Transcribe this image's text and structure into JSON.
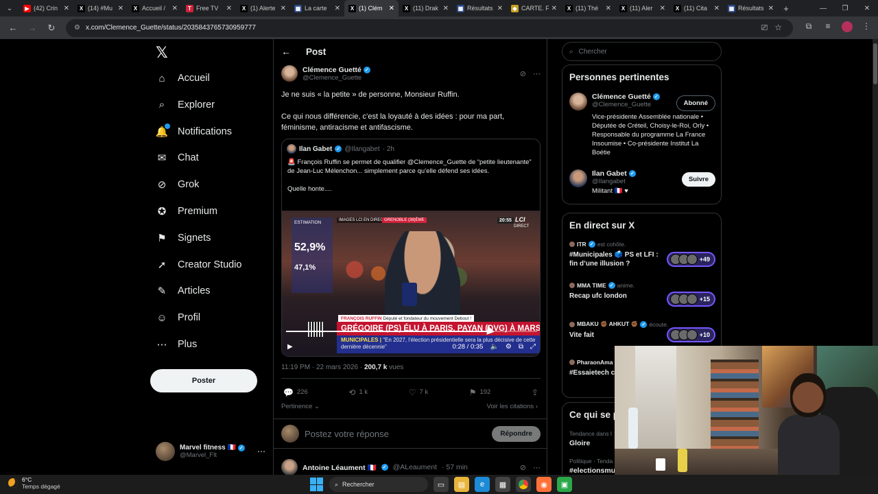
{
  "browser": {
    "tabs": [
      {
        "label": "(42) Crin",
        "fav": "▶",
        "color": "#ff0000"
      },
      {
        "label": "(14) #Mu",
        "fav": "X",
        "color": "#000000"
      },
      {
        "label": "Accueil /",
        "fav": "X",
        "color": "#000000"
      },
      {
        "label": "Free TV",
        "fav": "T",
        "color": "#d0213a"
      },
      {
        "label": "(1) Alerte",
        "fav": "X",
        "color": "#000000"
      },
      {
        "label": "La carte",
        "fav": "▦",
        "color": "#2a4a8a"
      },
      {
        "label": "(1) Clém",
        "fav": "X",
        "color": "#000000",
        "active": true
      },
      {
        "label": "(11) Drak",
        "fav": "X",
        "color": "#000000"
      },
      {
        "label": "Résultats",
        "fav": "▦",
        "color": "#2a4a8a"
      },
      {
        "label": "CARTE. F",
        "fav": "◆",
        "color": "#c8a020"
      },
      {
        "label": "(11) Thé",
        "fav": "X",
        "color": "#000000"
      },
      {
        "label": "(11) Aler",
        "fav": "X",
        "color": "#000000"
      },
      {
        "label": "(11) Cita",
        "fav": "X",
        "color": "#000000"
      },
      {
        "label": "Résultats",
        "fav": "▦",
        "color": "#2a4a8a"
      }
    ],
    "url": "x.com/Clemence_Guette/status/2035843765730959777"
  },
  "nav": {
    "items": [
      {
        "label": "Accueil",
        "icon": "home-icon",
        "glyph": "⌂"
      },
      {
        "label": "Explorer",
        "icon": "search-icon",
        "glyph": "⌕"
      },
      {
        "label": "Notifications",
        "icon": "bell-icon",
        "glyph": "🔔"
      },
      {
        "label": "Chat",
        "icon": "mail-icon",
        "glyph": "✉"
      },
      {
        "label": "Grok",
        "icon": "grok-icon",
        "glyph": "⊘"
      },
      {
        "label": "Premium",
        "icon": "premium-icon",
        "glyph": "✪"
      },
      {
        "label": "Signets",
        "icon": "bookmark-icon",
        "glyph": "⚑"
      },
      {
        "label": "Creator Studio",
        "icon": "rocket-icon",
        "glyph": "➚"
      },
      {
        "label": "Articles",
        "icon": "article-icon",
        "glyph": "✎"
      },
      {
        "label": "Profil",
        "icon": "person-icon",
        "glyph": "☺"
      },
      {
        "label": "Plus",
        "icon": "more-icon",
        "glyph": "⋯"
      }
    ],
    "post_button": "Poster",
    "account": {
      "name": "Marvel fitness 🇫🇷",
      "handle": "@Marvel_Flt"
    }
  },
  "post": {
    "header": "Post",
    "author_name": "Clémence Guetté",
    "author_handle": "@Clemence_Guette",
    "text_1": "Je ne suis « la petite » de personne, Monsieur Ruffin.",
    "text_2": "Ce qui nous différencie, c’est la loyauté à des idées : pour ma part, féminisme, antiracisme et antifascisme.",
    "quote": {
      "name": "Ilan Gabet",
      "handle": "@Ilangabet",
      "time": "· 2h",
      "text": "François Ruffin se permet de qualifier @Clemence_Guette de “petite lieutenante” de Jean-Luc Mélenchon... simplement parce qu’elle défend ses idées.",
      "text_2": "Quelle honte....",
      "siren": "🚨"
    },
    "video": {
      "tag_top": "IMAGES LCI EN DIRECT",
      "tag_city": "GRENOBLE (38)ÈME",
      "panel_label": "ESTIMATION",
      "panel_pct1": "52,9%",
      "panel_pct2": "47,1%",
      "clock": "20:55",
      "channel": "LCI",
      "direct": "DIRECT",
      "name_label": "FRANÇOIS RUFFIN",
      "name_role": "Député et fondateur du mouvement Debout !",
      "headline": "GRÉGOIRE (PS) ÉLU À PARIS, PAYAN (DVG) À MARSEILLE",
      "subline_prefix": "MUNICIPALES |",
      "subline": "\"En 2027, l'élection présidentielle sera la plus décisive de cette dernière décennie\"",
      "time": "0:28 / 0:35",
      "progress": 0.8
    },
    "timestamp": "11:19 PM · 22 mars 2026 ·",
    "views_count": "200,7 k",
    "views_label": "vues",
    "stats": {
      "replies": "226",
      "reposts": "1 k",
      "likes": "7 k",
      "bookmarks": "192"
    },
    "sort": "Pertinence",
    "citations": "Voir les citations",
    "reply_placeholder": "Postez votre réponse",
    "reply_button": "Répondre",
    "next": {
      "name": "Antoine Léaument 🇫🇷",
      "handle": "@ALeaument",
      "time": "· 57 min"
    }
  },
  "sidebar": {
    "search_placeholder": "Chercher",
    "people_title": "Personnes pertinentes",
    "people": [
      {
        "name": "Clémence Guetté",
        "handle": "@Clemence_Guette",
        "button": "Abonné",
        "bio": "Vice-présidente Assemblée nationale • Députée de Créteil, Choisy-le-Roi, Orly • Responsable du programme La France Insoumise • Co-présidente Institut La Boétie"
      },
      {
        "name": "Ilan Gabet",
        "handle": "@Ilangabet",
        "button": "Suivre",
        "bio": "Militant 🇫🇷 ♥"
      }
    ],
    "live_title": "En direct sur X",
    "live": [
      {
        "host": "ITR",
        "action": "est cohôte.",
        "title": "#Municipales 🗳️ PS et LFI : fin d’une illusion ?",
        "count": "+49"
      },
      {
        "host": "MMA TIME",
        "action": "anime.",
        "title": "Recap ufc london",
        "count": "+15"
      },
      {
        "host": "MBAKU ✊🏾 AHKUT ✊🏾",
        "action": "écoute.",
        "title": "Vite fait",
        "count": "+10"
      },
      {
        "host": "PharaonAma",
        "action": "",
        "title": "#Essaietech c de la constitu",
        "count": ""
      }
    ],
    "trends_title": "Ce qui se p",
    "trends": [
      {
        "label": "Tendance dans l",
        "name": "Gloire"
      },
      {
        "label": "Politique · Tenda",
        "name": "#electionsmu"
      }
    ]
  },
  "taskbar": {
    "temp": "6°C",
    "weather": "Temps dégagé",
    "search": "Rechercher"
  }
}
